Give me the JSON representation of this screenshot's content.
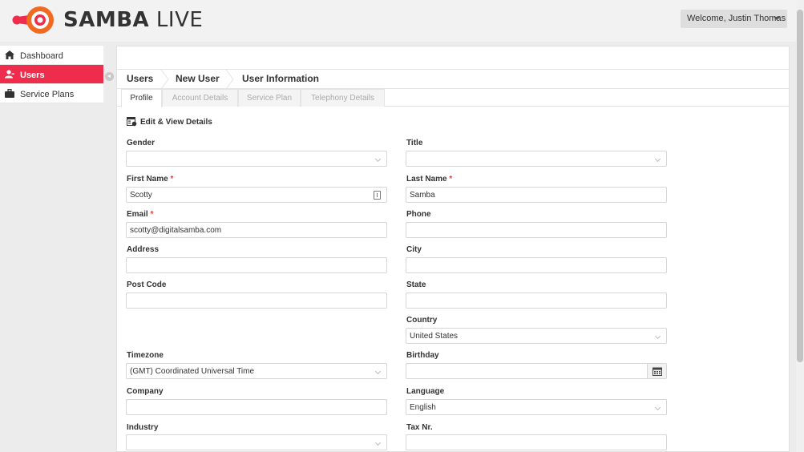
{
  "header": {
    "logo_text_bold": "SAMBA",
    "logo_text_light": " LIVE",
    "welcome": "Welcome, Justin Thomas",
    "brand_color": "#ee2c4c",
    "logo_orange": "#f26a22"
  },
  "sidebar": {
    "items": [
      {
        "label": "Dashboard",
        "icon": "home-icon"
      },
      {
        "label": "Users",
        "icon": "users-icon"
      },
      {
        "label": "Service Plans",
        "icon": "briefcase-icon"
      }
    ]
  },
  "breadcrumb": [
    "Users",
    "New User",
    "User Information"
  ],
  "tabs": [
    "Profile",
    "Account Details",
    "Service Plan",
    "Telephony Details"
  ],
  "section_title": "Edit & View Details",
  "form": {
    "gender": {
      "label": "Gender",
      "value": ""
    },
    "title": {
      "label": "Title",
      "value": ""
    },
    "first_name": {
      "label": "First Name",
      "value": "Scotty"
    },
    "last_name": {
      "label": "Last Name",
      "value": "Samba"
    },
    "email": {
      "label": "Email",
      "value": "scotty@digitalsamba.com"
    },
    "phone": {
      "label": "Phone",
      "value": ""
    },
    "address": {
      "label": "Address",
      "value": ""
    },
    "city": {
      "label": "City",
      "value": ""
    },
    "post_code": {
      "label": "Post Code",
      "value": ""
    },
    "state": {
      "label": "State",
      "value": ""
    },
    "country": {
      "label": "Country",
      "value": "United States"
    },
    "timezone": {
      "label": "Timezone",
      "value": "(GMT) Coordinated Universal Time"
    },
    "birthday": {
      "label": "Birthday",
      "value": ""
    },
    "company": {
      "label": "Company",
      "value": ""
    },
    "language": {
      "label": "Language",
      "value": "English"
    },
    "industry": {
      "label": "Industry",
      "value": ""
    },
    "tax_nr": {
      "label": "Tax Nr.",
      "value": ""
    },
    "required_mark": "*"
  }
}
